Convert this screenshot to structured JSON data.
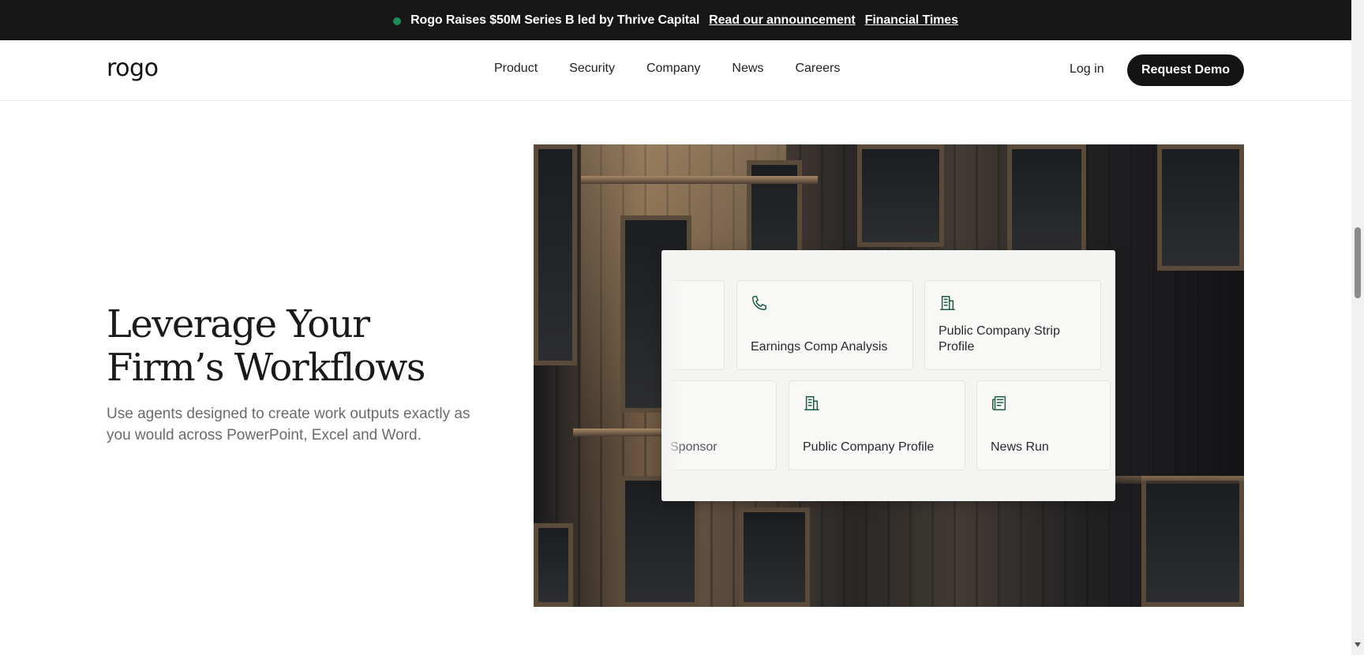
{
  "announcement": {
    "message": "Rogo Raises $50M Series B led by Thrive Capital",
    "link_announcement": "Read our announcement",
    "link_press": "Financial Times",
    "dot_color": "#1e8a5a"
  },
  "nav": {
    "logo": "rogo",
    "links": [
      "Product",
      "Security",
      "Company",
      "News",
      "Careers"
    ],
    "login": "Log in",
    "cta": "Request Demo"
  },
  "hero": {
    "heading_line1": "Leverage Your",
    "heading_line2": "Firm’s Workflows",
    "subtext": "Use agents designed to create work outputs exactly as you would across PowerPoint, Excel and Word."
  },
  "workflow_cards": {
    "row1": [
      {
        "label": "",
        "icon": "partial-card"
      },
      {
        "label": "Earnings Comp Analysis",
        "icon": "phone-icon"
      },
      {
        "label": "Public Company Strip Profile",
        "icon": "building-icon"
      }
    ],
    "row2": [
      {
        "label": "Sponsor",
        "icon": "partial-card"
      },
      {
        "label": "Public Company Profile",
        "icon": "building-icon"
      },
      {
        "label": "News Run",
        "icon": "newspaper-icon"
      }
    ],
    "icon_color": "#1f5a44"
  }
}
